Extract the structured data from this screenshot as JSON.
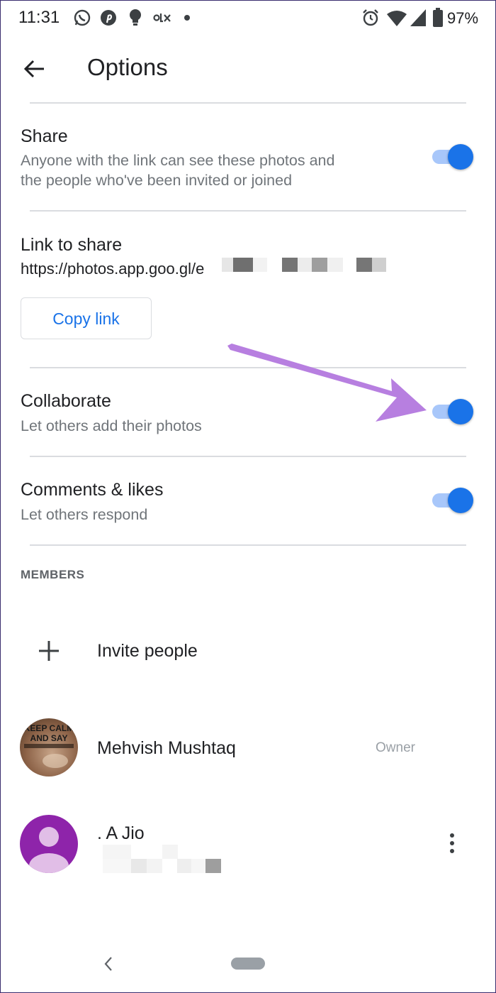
{
  "status_bar": {
    "time": "11:31",
    "battery": "97%",
    "notification_icons": [
      "whatsapp-icon",
      "pinterest-icon",
      "bulb-icon",
      "olx-icon",
      "dot-icon"
    ],
    "system_icons": [
      "alarm-icon",
      "wifi-icon",
      "signal-icon",
      "battery-icon"
    ]
  },
  "app_bar": {
    "title": "Options"
  },
  "share": {
    "title": "Share",
    "subtitle_line1": "Anyone with the link can see these photos and",
    "subtitle_line2": "the people who've been invited or joined",
    "enabled": true
  },
  "link": {
    "title": "Link to share",
    "url": "https://photos.app.goo.gl/e",
    "copy_label": "Copy link"
  },
  "collaborate": {
    "title": "Collaborate",
    "subtitle": "Let others add their photos",
    "enabled": true
  },
  "comments": {
    "title": "Comments & likes",
    "subtitle": "Let others respond",
    "enabled": true
  },
  "members": {
    "section_label": "MEMBERS",
    "invite_label": "Invite people",
    "list": [
      {
        "name": "Mehvish Mushtaq",
        "role": "Owner",
        "avatar_text_1": "KEEP CALM",
        "avatar_text_2": "AND SAY"
      },
      {
        "name": ". A Jio"
      }
    ]
  },
  "colors": {
    "accent": "#1a73e8",
    "toggle_track": "#a8c7fa",
    "annotation_arrow": "#b77fe0",
    "avatar_purple": "#8e24aa"
  }
}
